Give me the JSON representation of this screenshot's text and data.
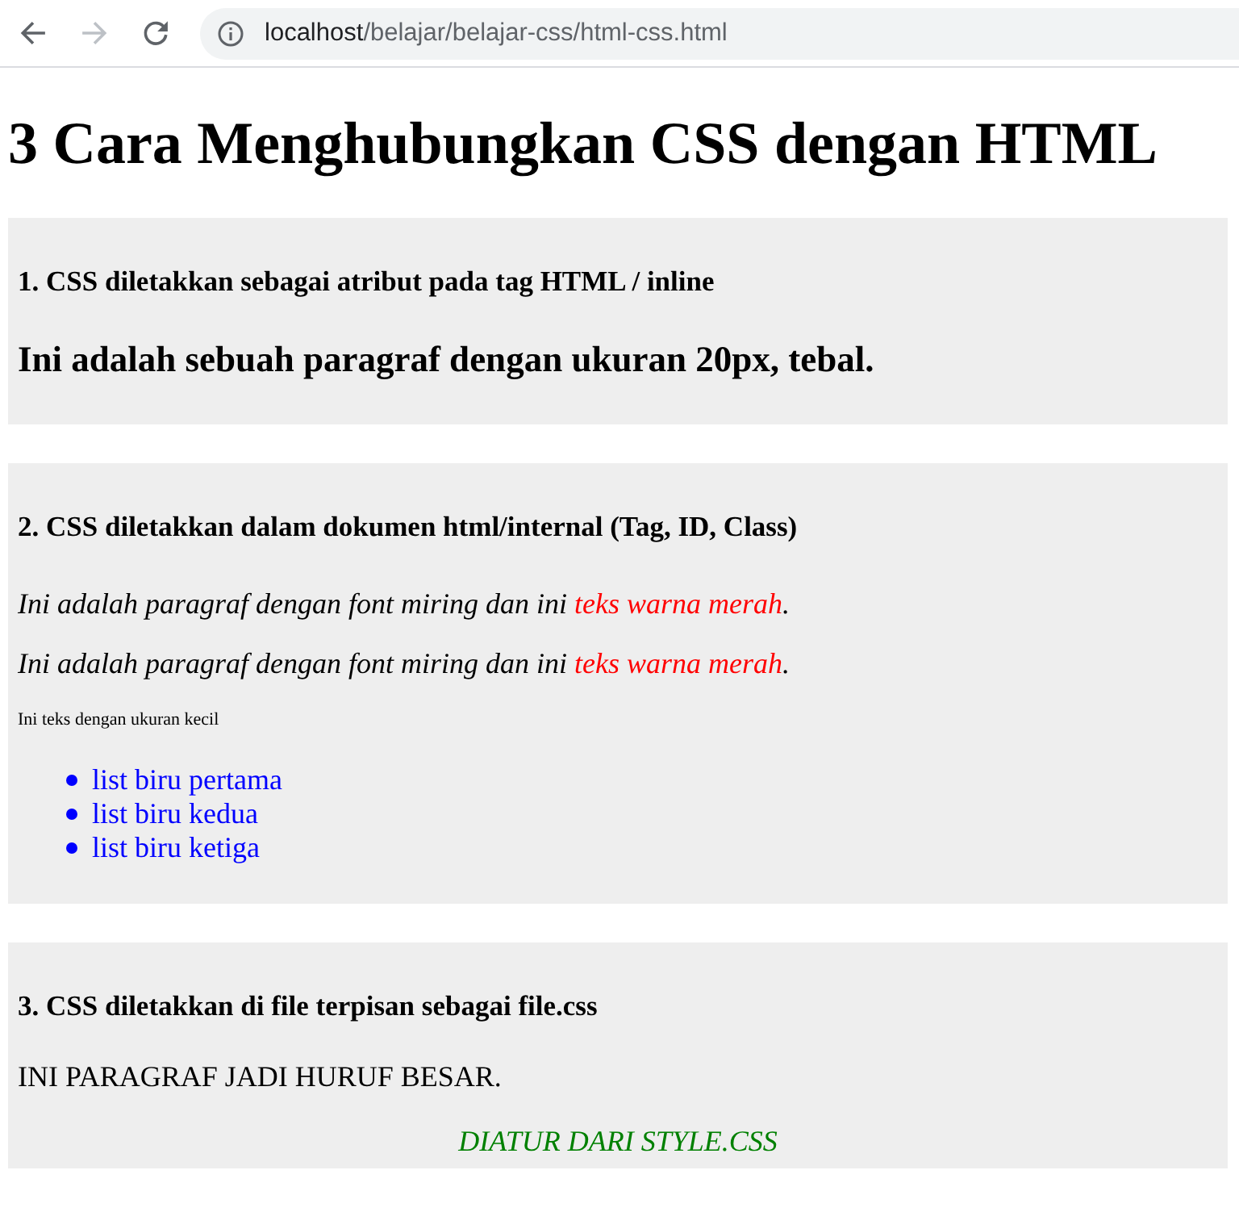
{
  "browser": {
    "back": {
      "disabled": false
    },
    "forward": {
      "disabled": true
    },
    "address": {
      "host": "localhost",
      "path": "/belajar/belajar-css/html-css.html"
    }
  },
  "page": {
    "title": "3 Cara Menghubungkan CSS dengan HTML",
    "sections": [
      {
        "heading": "1. CSS diletakkan sebagai atribut pada tag HTML / inline",
        "blocks": [
          {
            "kind": "lead",
            "text": "Ini adalah sebuah paragraf dengan ukuran 20px, tebal."
          }
        ]
      },
      {
        "heading": "2. CSS diletakkan dalam dokumen html/internal (Tag, ID, Class)",
        "blocks": [
          {
            "kind": "italic",
            "parts": [
              {
                "text": "Ini adalah paragraf dengan font miring dan ini "
              },
              {
                "text": "teks warna merah",
                "color": "#ff0000"
              },
              {
                "text": "."
              }
            ]
          },
          {
            "kind": "italic",
            "parts": [
              {
                "text": "Ini adalah paragraf dengan font miring dan ini "
              },
              {
                "text": "teks warna merah",
                "color": "#ff0000"
              },
              {
                "text": "."
              }
            ]
          },
          {
            "kind": "small",
            "text": "Ini teks dengan ukuran kecil"
          },
          {
            "kind": "list",
            "items": [
              "list biru pertama",
              "list biru kedua",
              "list biru ketiga"
            ]
          }
        ]
      },
      {
        "heading": "3. CSS diletakkan di file terpisan sebagai file.css",
        "blocks": [
          {
            "kind": "plain",
            "text": "INI PARAGRAF JADI HURUF BESAR."
          },
          {
            "kind": "note",
            "text": "DIATUR DARI STYLE.CSS"
          }
        ]
      }
    ]
  }
}
